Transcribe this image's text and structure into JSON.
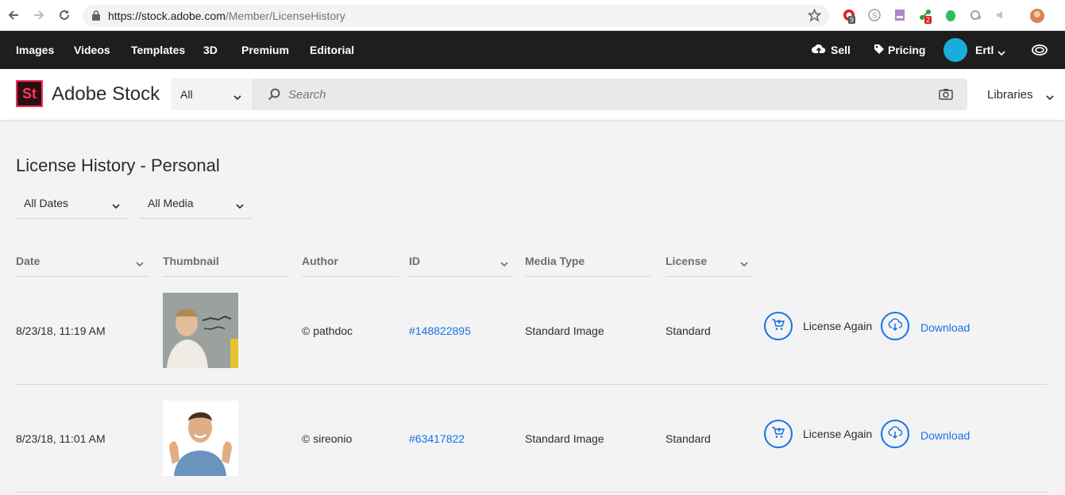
{
  "browser": {
    "url_host": "https://stock.adobe.com",
    "url_path": "/Member/LicenseHistory",
    "extension_badges": [
      "9",
      "2"
    ]
  },
  "topnav": {
    "items": [
      "Images",
      "Videos",
      "Templates",
      "3D",
      "Premium",
      "Editorial"
    ],
    "sell_label": "Sell",
    "pricing_label": "Pricing",
    "user_name": "Ertl"
  },
  "header": {
    "logo_mark": "St",
    "logo_text": "Adobe Stock",
    "filter_value": "All",
    "search_placeholder": "Search",
    "libraries_label": "Libraries"
  },
  "page": {
    "title": "License History - Personal",
    "date_filter": "All Dates",
    "media_filter": "All Media"
  },
  "table": {
    "columns": [
      "Date",
      "Thumbnail",
      "Author",
      "ID",
      "Media Type",
      "License"
    ],
    "rows": [
      {
        "date": "8/23/18, 11:19 AM",
        "author": "© pathdoc",
        "id": "#148822895",
        "media_type": "Standard Image",
        "license": "Standard",
        "license_again": "License Again",
        "download": "Download"
      },
      {
        "date": "8/23/18, 11:01 AM",
        "author": "© sireonio",
        "id": "#63417822",
        "media_type": "Standard Image",
        "license": "Standard",
        "license_again": "License Again",
        "download": "Download"
      }
    ]
  },
  "colors": {
    "accent_blue": "#1473e6",
    "topnav_bg": "#1e1e1e",
    "logo_pink": "#ff3366",
    "avatar": "#18aed9"
  }
}
